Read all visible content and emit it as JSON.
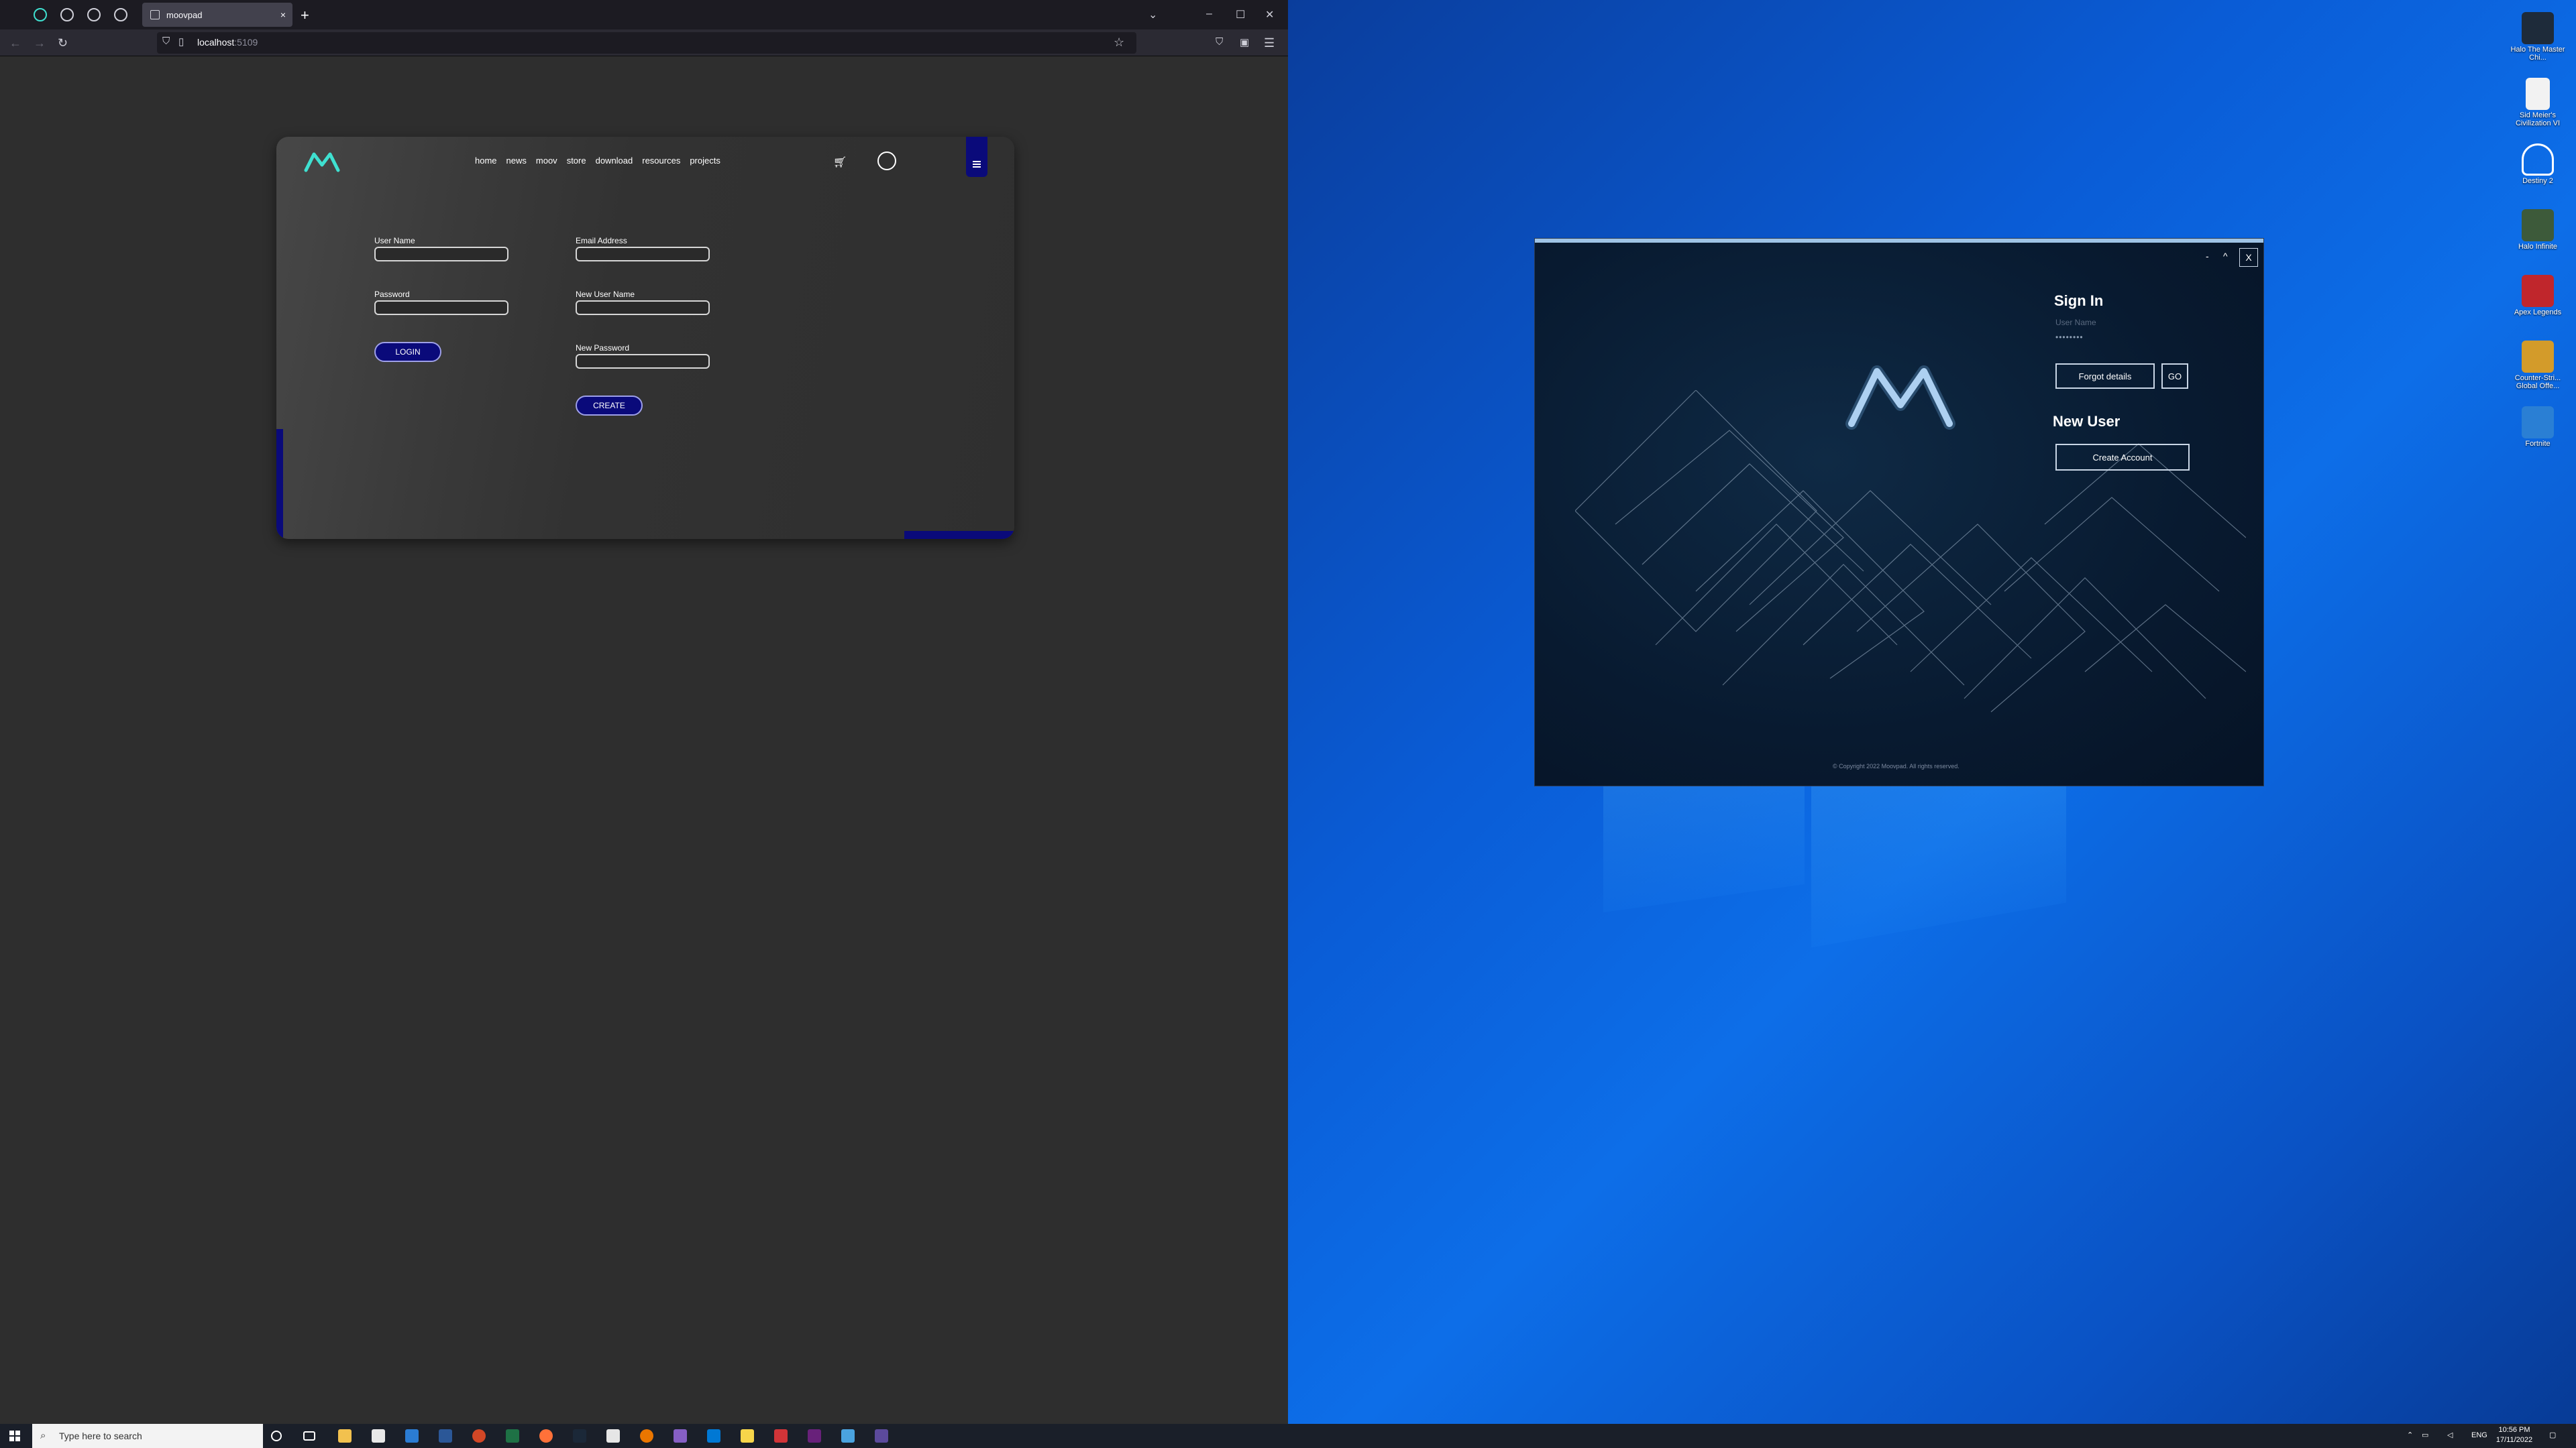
{
  "browser": {
    "tab_title": "moovpad",
    "url_host": "localhost",
    "url_port": ":5109",
    "new_tab_symbol": "+",
    "close_symbol": "×"
  },
  "site": {
    "nav": [
      "home",
      "news",
      "moov",
      "store",
      "download",
      "resources",
      "projects"
    ],
    "login": {
      "username_label": "User Name",
      "password_label": "Password",
      "button": "LOGIN"
    },
    "register": {
      "email_label": "Email Address",
      "new_username_label": "New User Name",
      "new_password_label": "New Password",
      "button": "CREATE"
    }
  },
  "launcher": {
    "close_label": "X",
    "minimize_label": "-",
    "maximize_label": "^",
    "signin_title": "Sign In",
    "username_placeholder": "User Name",
    "password_mask": "••••••••",
    "forgot_button": "Forgot details",
    "go_button": "GO",
    "new_user_title": "New User",
    "create_account_button": "Create Account",
    "copyright": "© Copyright 2022 Moovpad. All rights reserved."
  },
  "desktop_icons": [
    {
      "label": "Halo The Master Chi...",
      "color": "#1e2b3a"
    },
    {
      "label": "Sid Meier's Civilization VI",
      "color": "#f2f2f2"
    },
    {
      "label": "Destiny 2",
      "color": "#ffffff"
    },
    {
      "label": "Halo Infinite",
      "color": "#3d5a3a"
    },
    {
      "label": "Apex Legends",
      "color": "#c0262c"
    },
    {
      "label": "Counter-Stri... Global Offe...",
      "color": "#d39b2a"
    },
    {
      "label": "Fortnite",
      "color": "#2a7fd4"
    }
  ],
  "taskbar": {
    "search_placeholder": "Type here to search",
    "language": "ENG",
    "time": "10:56 PM",
    "date": "17/11/2022"
  },
  "colors": {
    "accent_navy": "#0a0a7a",
    "logo_teal": "#3fe0d0",
    "desktop_blue": "#0a5cd6"
  }
}
